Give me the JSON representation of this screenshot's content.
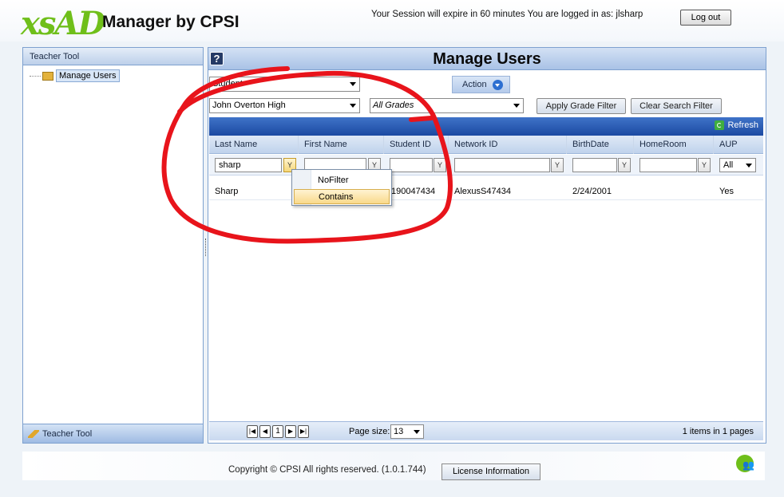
{
  "header": {
    "logo_text": "xsAD",
    "brand": "Manager by CPSI",
    "session_text": "Your Session will expire in 60 minutes  You are logged in as: jlsharp",
    "logout_label": "Log out"
  },
  "left_panel": {
    "title": "Teacher Tool",
    "tree_item": "Manage Users",
    "footer_label": "Teacher Tool",
    "folder_icon": "folder-icon",
    "pencil_icon": "pencil-icon"
  },
  "main": {
    "title": "Manage Users",
    "help_icon": "?",
    "user_type_select": "Student",
    "school_select": "John Overton High",
    "grades_select": "All Grades",
    "apply_grade_filter": "Apply Grade Filter",
    "clear_search_filter": "Clear Search Filter",
    "action_label": "Action",
    "refresh_label": "Refresh"
  },
  "grid": {
    "columns": [
      "Last Name",
      "First Name",
      "Student ID",
      "Network ID",
      "BirthDate",
      "HomeRoom",
      "AUP"
    ],
    "filters": {
      "last_name": "sharp",
      "aup": "All"
    },
    "rows": [
      {
        "last_name": "Sharp",
        "first_name": "",
        "student_id": "190047434",
        "network_id": "AlexusS47434",
        "birthdate": "2/24/2001",
        "homeroom": "",
        "aup": "Yes"
      }
    ],
    "filter_menu": [
      "NoFilter",
      "Contains"
    ],
    "filter_menu_highlighted": "Contains"
  },
  "pager": {
    "current_page": "1",
    "page_size_label": "Page size:",
    "page_size": "13",
    "summary": "1 items in 1 pages"
  },
  "footer": {
    "copyright": "Copyright © CPSI All rights reserved. (1.0.1.744)",
    "license_label": "License Information"
  },
  "colors": {
    "accent": "#1c4aa2",
    "logo_green": "#6fbf1a",
    "annotation_red": "#e8141b"
  }
}
